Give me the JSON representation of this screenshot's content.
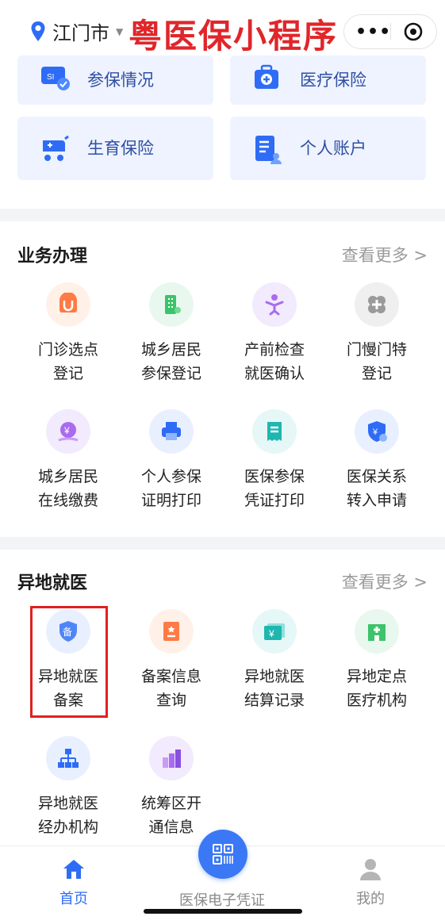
{
  "header": {
    "city": "江门市",
    "app_title": "粤医保小程序"
  },
  "top_cards": [
    {
      "label": "参保情况",
      "icon": "insurance-card-icon"
    },
    {
      "label": "医疗保险",
      "icon": "medical-kit-icon"
    },
    {
      "label": "生育保险",
      "icon": "stroller-icon"
    },
    {
      "label": "个人账户",
      "icon": "account-doc-icon"
    }
  ],
  "business": {
    "title": "业务办理",
    "more": "查看更多 >",
    "items": [
      {
        "line1": "门诊选点",
        "line2": "登记",
        "icon": "hospital-register-icon"
      },
      {
        "line1": "城乡居民",
        "line2": "参保登记",
        "icon": "building-icon"
      },
      {
        "line1": "产前检查",
        "line2": "就医确认",
        "icon": "person-icon"
      },
      {
        "line1": "门慢门特",
        "line2": "登记",
        "icon": "medical-cross-icon"
      },
      {
        "line1": "城乡居民",
        "line2": "在线缴费",
        "icon": "yuan-coin-icon"
      },
      {
        "line1": "个人参保",
        "line2": "证明打印",
        "icon": "printer-icon"
      },
      {
        "line1": "医保参保",
        "line2": "凭证打印",
        "icon": "receipt-icon"
      },
      {
        "line1": "医保关系",
        "line2": "转入申请",
        "icon": "shield-yuan-icon"
      }
    ]
  },
  "remote": {
    "title": "异地就医",
    "more": "查看更多 >",
    "items": [
      {
        "line1": "异地就医",
        "line2": "备案",
        "icon": "shield-record-icon",
        "badge": "备"
      },
      {
        "line1": "备案信息",
        "line2": "查询",
        "icon": "document-search-icon"
      },
      {
        "line1": "异地就医",
        "line2": "结算记录",
        "icon": "yuan-card-icon"
      },
      {
        "line1": "异地定点",
        "line2": "医疗机构",
        "icon": "hospital-icon"
      },
      {
        "line1": "异地就医",
        "line2": "经办机构",
        "icon": "org-chart-icon"
      },
      {
        "line1": "统筹区开",
        "line2": "通信息",
        "icon": "bar-building-icon"
      }
    ]
  },
  "tabbar": {
    "home": "首页",
    "card": "医保电子凭证",
    "mine": "我的"
  },
  "colors": {
    "accent": "#2f6cf6",
    "title_red": "#e0262a",
    "highlight": "#e02020"
  }
}
